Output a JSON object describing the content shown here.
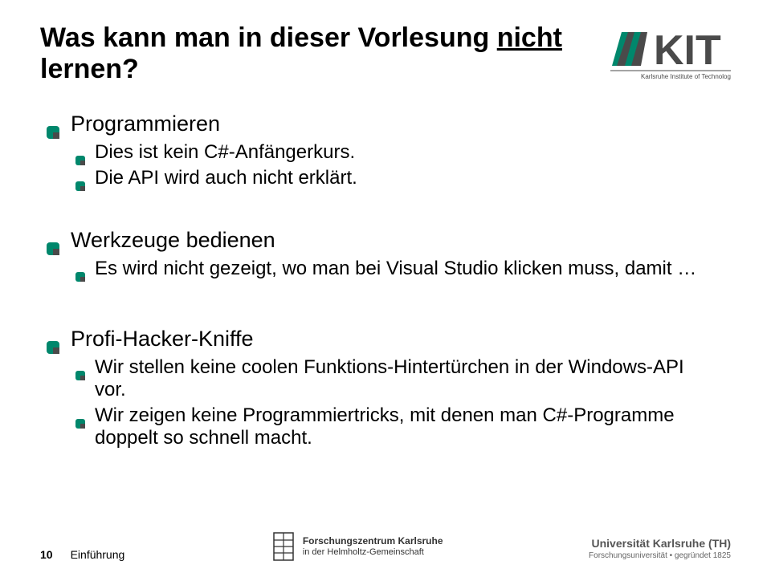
{
  "title": {
    "pre": "Was kann man in dieser Vorlesung ",
    "underlined": "nicht",
    "post": " lernen?"
  },
  "logo": {
    "kit_sub": "Karlsruhe Institute of Technology"
  },
  "sections": [
    {
      "heading": "Programmieren",
      "items": [
        "Dies ist kein C#-Anfängerkurs.",
        "Die API wird auch nicht erklärt."
      ]
    },
    {
      "heading": "Werkzeuge bedienen",
      "items": [
        "Es wird nicht gezeigt, wo man bei Visual Studio klicken muss, damit …"
      ]
    },
    {
      "heading": "Profi-Hacker-Kniffe",
      "items": [
        "Wir stellen keine coolen Funktions-Hintertürchen in der Windows-API vor.",
        "Wir zeigen keine Programmiertricks, mit denen man C#-Programme doppelt so schnell macht."
      ]
    }
  ],
  "footer": {
    "page": "10",
    "label": "Einführung",
    "fz_line1": "Forschungszentrum Karlsruhe",
    "fz_line2": "in der Helmholtz-Gemeinschaft",
    "uni_line1": "Universität Karlsruhe (TH)",
    "uni_line2": "Forschungsuniversität • gegründet 1825"
  },
  "colors": {
    "accent": "#00876C",
    "accent_dark": "#4A4A4A"
  }
}
